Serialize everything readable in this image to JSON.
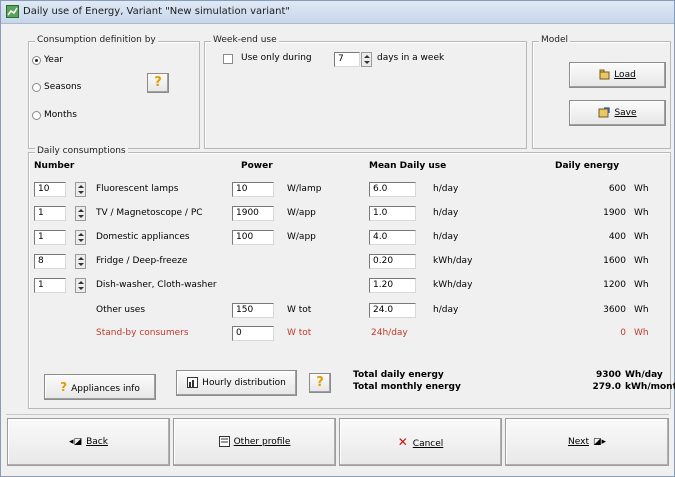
{
  "window": {
    "title": "Daily use of Energy, Variant  \"New simulation variant\""
  },
  "consumption_def": {
    "label": "Consumption definition by",
    "options": [
      "Year",
      "Seasons",
      "Months"
    ],
    "selected": "Year",
    "help": "?"
  },
  "weekend": {
    "label": "Week-end use",
    "check_label": "Use only during",
    "days_value": "7",
    "days_suffix": "days in a week"
  },
  "model": {
    "label": "Model",
    "load_label": "Load",
    "save_label": "Save"
  },
  "daily": {
    "label": "Daily consumptions",
    "headers": {
      "number": "Number",
      "power": "Power",
      "mean": "Mean Daily use",
      "energy": "Daily energy"
    },
    "rows": [
      {
        "number": "10",
        "name": "Fluorescent lamps",
        "power": "10",
        "power_unit": "W/lamp",
        "mean": "6.0",
        "mean_unit": "h/day",
        "energy": "600",
        "energy_unit": "Wh"
      },
      {
        "number": "1",
        "name": "TV / Magnetoscope / PC",
        "power": "1900",
        "power_unit": "W/app",
        "mean": "1.0",
        "mean_unit": "h/day",
        "energy": "1900",
        "energy_unit": "Wh"
      },
      {
        "number": "1",
        "name": "Domestic appliances",
        "power": "100",
        "power_unit": "W/app",
        "mean": "4.0",
        "mean_unit": "h/day",
        "energy": "400",
        "energy_unit": "Wh"
      },
      {
        "number": "8",
        "name": "Fridge / Deep-freeze",
        "power": "",
        "power_unit": "",
        "mean": "0.20",
        "mean_unit": "kWh/day",
        "energy": "1600",
        "energy_unit": "Wh"
      },
      {
        "number": "1",
        "name": "Dish-washer,  Cloth-washer",
        "power": "",
        "power_unit": "",
        "mean": "1.20",
        "mean_unit": "kWh/day",
        "energy": "1200",
        "energy_unit": "Wh"
      }
    ],
    "other": {
      "name": "Other uses",
      "power": "150",
      "power_unit": "W tot",
      "mean": "24.0",
      "mean_unit": "h/day",
      "energy": "3600",
      "energy_unit": "Wh"
    },
    "standby": {
      "name": "Stand-by consumers",
      "power": "0",
      "power_unit": "W tot",
      "mean_text": "24h/day",
      "energy": "0",
      "energy_unit": "Wh"
    },
    "appliances_info_label": "Appliances info",
    "hourly_label": "Hourly distribution",
    "help": "?",
    "total_daily_label": "Total daily energy",
    "total_daily_value": "9300",
    "total_daily_unit": "Wh/day",
    "total_monthly_label": "Total monthly energy",
    "total_monthly_value": "279.0",
    "total_monthly_unit": "kWh/month"
  },
  "footer": {
    "back_label": "Back",
    "other_profile_label": "Other profile",
    "cancel_label": "Cancel",
    "next_label": "Next"
  },
  "colors": {
    "standby_red": "#c0392b",
    "help_yellow": "#e0a000",
    "cancel_red": "#d01010"
  }
}
